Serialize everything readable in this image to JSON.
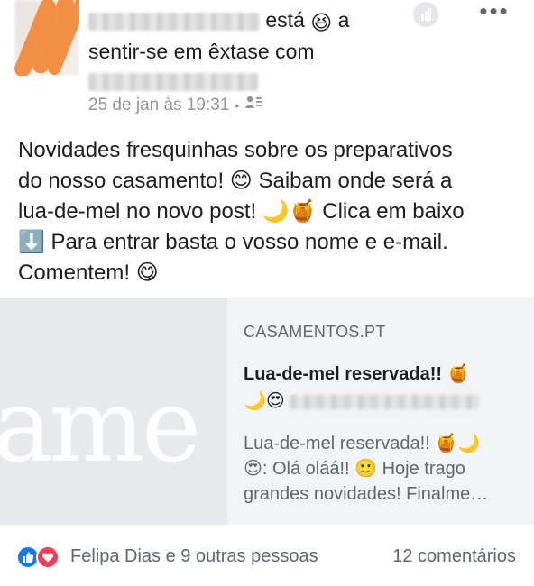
{
  "header": {
    "status_verb": "está",
    "status_preposition": "a",
    "feeling_text": "sentir-se em êxtase com",
    "timestamp": "25 de jan às 19:31",
    "separator": "•",
    "feeling_emoji": "😆",
    "audience_icon": "friends-list-icon",
    "insights_icon": "bar-chart-icon",
    "more_icon": "more-options-icon",
    "more_glyph": "•••"
  },
  "post": {
    "lines": [
      "Novidades fresquinhas sobre os preparativos",
      "do nosso casamento! 😊 Saibam onde será a",
      "lua-de-mel no novo post! 🌙🍯 Clica em baixo",
      "⬇️ Para entrar basta o vosso nome e e-mail.",
      "Comentem! 😋"
    ]
  },
  "link_card": {
    "image_watermark": "ame",
    "domain": "CASAMENTOS.PT",
    "title": "Lua-de-mel reservada!! 🍯",
    "title_line2_emojis": "🌙😍",
    "description_lines": [
      "Lua-de-mel reservada!! 🍯🌙",
      "😍: Olá oláá!! 🙂 Hoje trago",
      "grandes novidades! Finalme…"
    ]
  },
  "footer": {
    "reactions_text": "Felipa Dias e 9 outras pessoas",
    "comments_text": "12 comentários",
    "like_icon": "thumbs-up-icon",
    "love_icon": "heart-icon"
  },
  "colors": {
    "like_blue": "#1877f2",
    "love_red": "#f33e58",
    "meta_gray": "#90949c",
    "card_bg": "#f2f3f5"
  }
}
